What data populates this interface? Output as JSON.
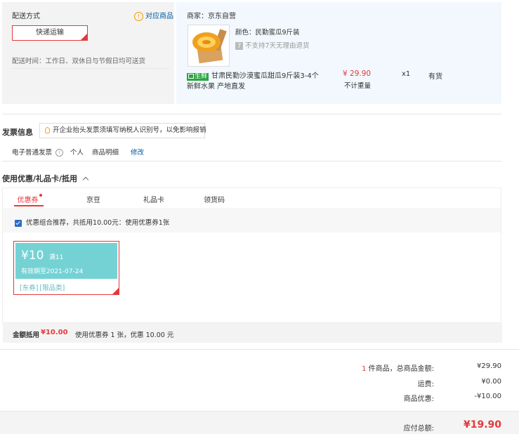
{
  "delivery": {
    "title": "配送方式",
    "match_goods_label": "对应商品",
    "option": "快递运输",
    "time": "配送时间：工作日、双休日与节假日均可送货"
  },
  "product": {
    "seller": "商家：京东自营",
    "color": "颜色：民勤蜜瓜9斤装",
    "no_return": "不支持7天无理由退货",
    "fresh_tag": "生鲜",
    "name_line1": "甘肃民勤沙漠蜜瓜甜瓜9斤装3-4个",
    "name_line2": "新鲜水果 产地直发",
    "price": "¥ 29.90",
    "weight_note": "不计重量",
    "qty": "x1",
    "stock": "有货"
  },
  "invoice": {
    "title": "发票信息",
    "tip": "开企业抬头发票须填写纳税人识别号，以免影响报销",
    "type": "电子普通发票",
    "holder": "个人",
    "content": "商品明细",
    "edit": "修改"
  },
  "discounts": {
    "title": "使用优惠/礼品卡/抵用",
    "tabs": [
      "优惠券",
      "京豆",
      "礼品卡",
      "领货码"
    ],
    "combo_text": "优惠组合推荐，共抵用10.00元：使用优惠券1张",
    "coupon": {
      "symbol": "¥",
      "amount": "10",
      "condition": "满11",
      "expiry": "有效期至2021-07-24",
      "tag1": "[东券]",
      "tag2": "[限品类]"
    },
    "offset_label": "金额抵用",
    "offset_amount": "¥10.00",
    "offset_desc": "使用优惠券 1 张，优惠 10.00 元"
  },
  "summary": {
    "count": "1",
    "count_label": "件商品，总商品金额:",
    "total": "¥29.90",
    "shipping_label": "运费:",
    "shipping": "¥0.00",
    "discount_label": "商品优惠:",
    "discount": "-¥10.00",
    "payable_label": "应付总额:",
    "payable": "¥19.90"
  },
  "colors": {
    "accent": "#e4393c",
    "coupon": "#74d2d4",
    "link": "#005aa0"
  }
}
